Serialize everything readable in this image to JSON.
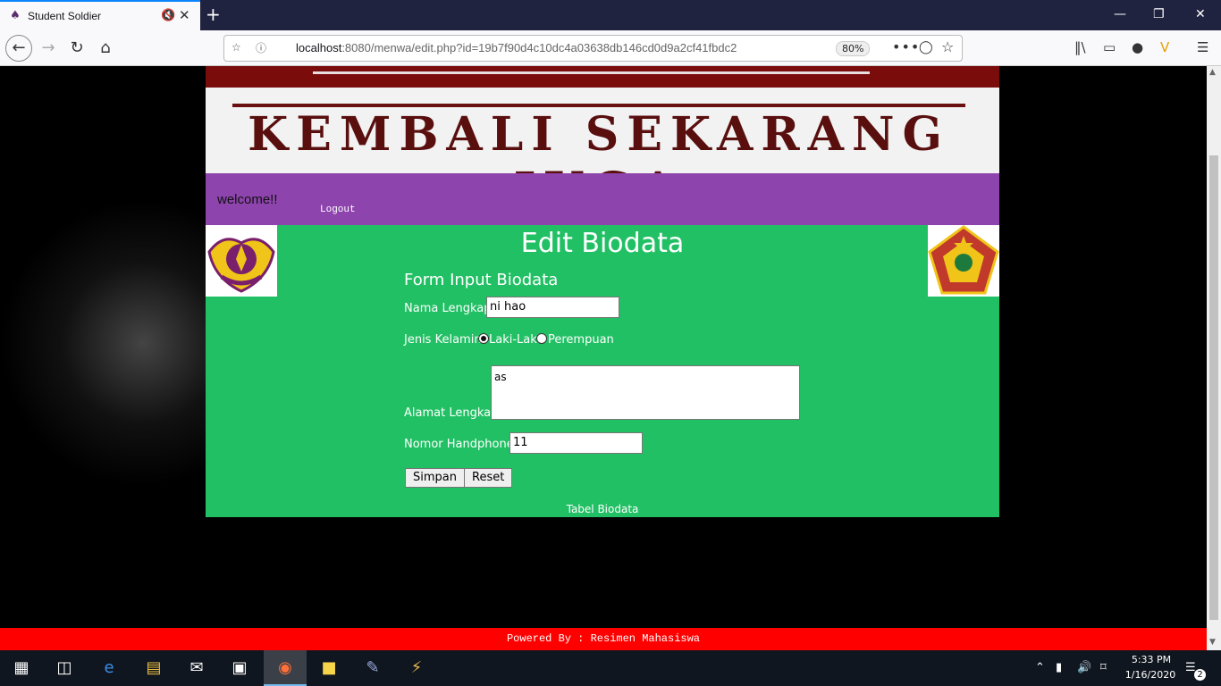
{
  "browser": {
    "tab_title": "Student Soldier",
    "url_host": "localhost",
    "url_rest": ":8080/menwa/edit.php?id=19b7f90d4c10dc4a03638db146cd0d9a2cf41fbdc2",
    "zoom": "80%"
  },
  "banner": {
    "text": "KEMBALI SEKARANG JUGA"
  },
  "nav": {
    "welcome": "welcome!!",
    "logout": "Logout"
  },
  "main": {
    "title": "Edit Biodata",
    "form_title": "Form Input Biodata",
    "nama_label": "Nama Lengkap",
    "nama_value": "ni hao",
    "gender_label": "Jenis Kelamin",
    "gender_options": [
      "Laki-Laki",
      "Perempuan"
    ],
    "gender_selected": "Laki-Laki",
    "alamat_label": "Alamat Lengkap",
    "alamat_value": "as",
    "hp_label": "Nomor Handphone",
    "hp_value": "11",
    "save_label": "Simpan",
    "reset_label": "Reset",
    "table_link": "Tabel Biodata"
  },
  "footer": {
    "text": "Powered By : Resimen Mahasiswa"
  },
  "taskbar": {
    "time": "5:33 PM",
    "date": "1/16/2020",
    "notifications": "2"
  }
}
